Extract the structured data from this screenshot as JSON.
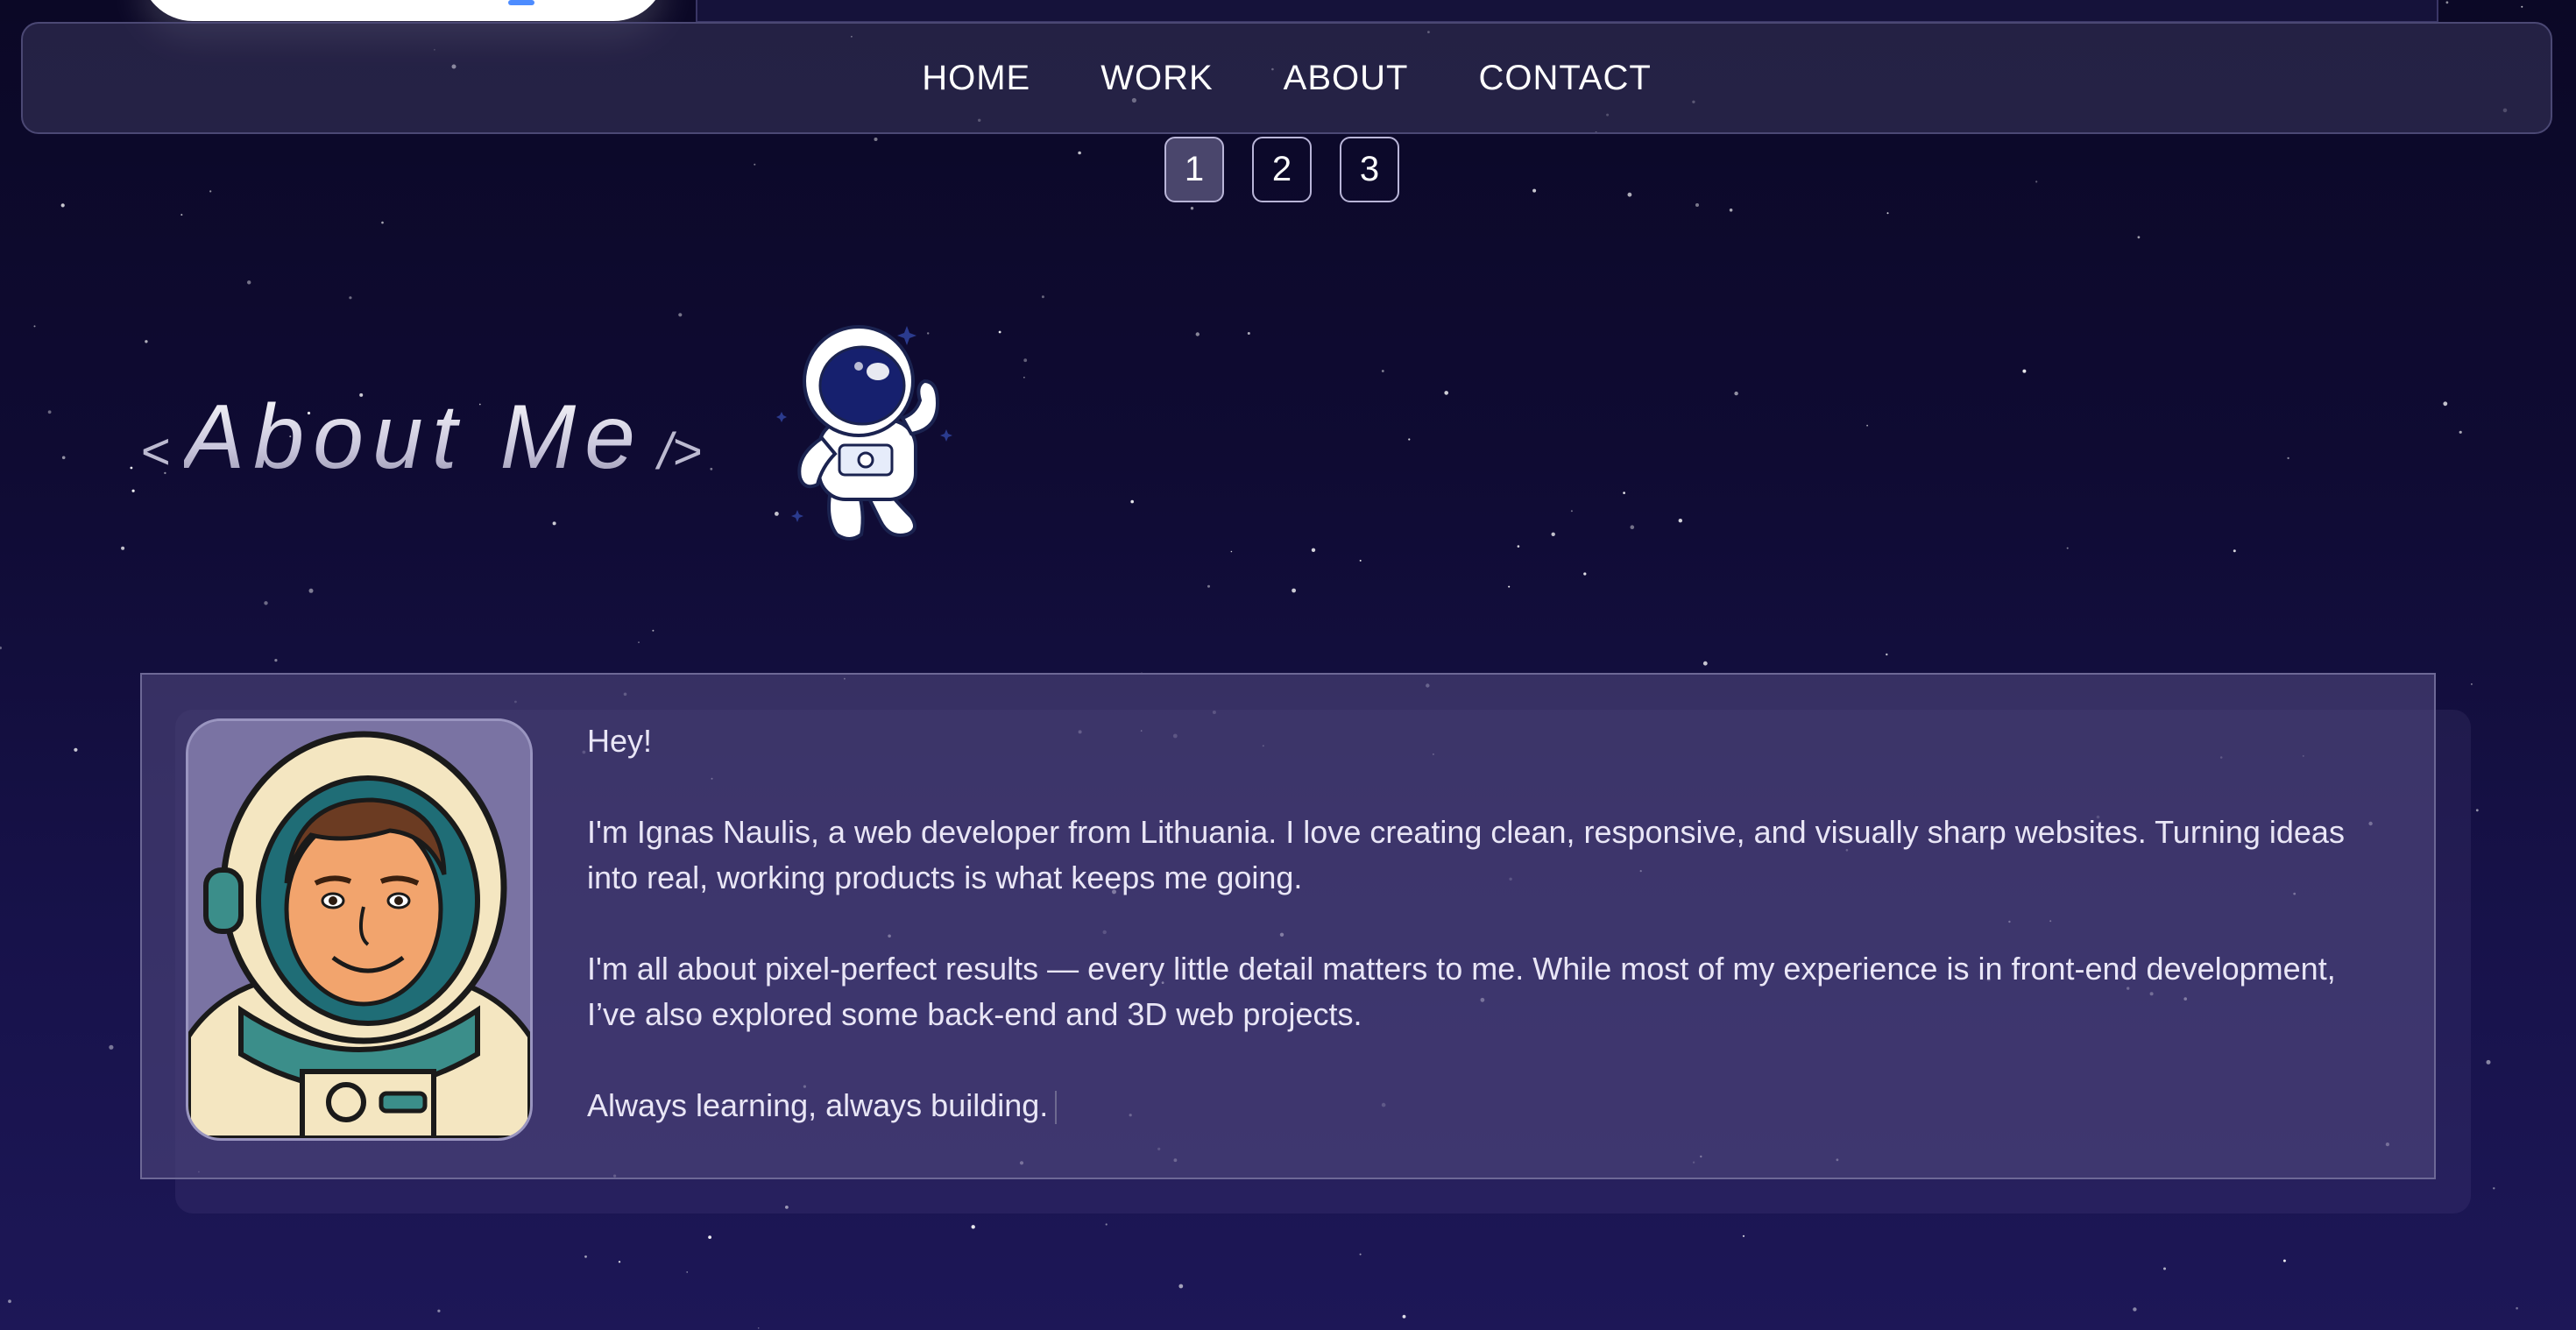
{
  "nav": {
    "items": [
      "HOME",
      "WORK",
      "ABOUT",
      "CONTACT"
    ]
  },
  "pagination": {
    "pages": [
      "1",
      "2",
      "3"
    ],
    "active": "1"
  },
  "about": {
    "bracket_open": "<",
    "title": "About Me",
    "bracket_close": "/>",
    "greeting": "Hey!",
    "paragraph1": "I'm Ignas Naulis, a web developer from Lithuania. I love creating clean, responsive, and visually sharp websites. Turning ideas into real, working products is what keeps me going.",
    "paragraph2": "I'm all about pixel-perfect results — every little detail matters to me. While most of my experience is in front-end development, I’ve also explored some back-end and 3D web projects.",
    "closing": "Always learning, always building."
  },
  "icons": {
    "mascot": "astronaut-mascot-icon",
    "avatar": "astronaut-portrait-avatar"
  },
  "colors": {
    "background_top": "#0b0826",
    "background_bottom": "#1d1757",
    "card": "#4e467a",
    "accent": "#ffffff"
  }
}
